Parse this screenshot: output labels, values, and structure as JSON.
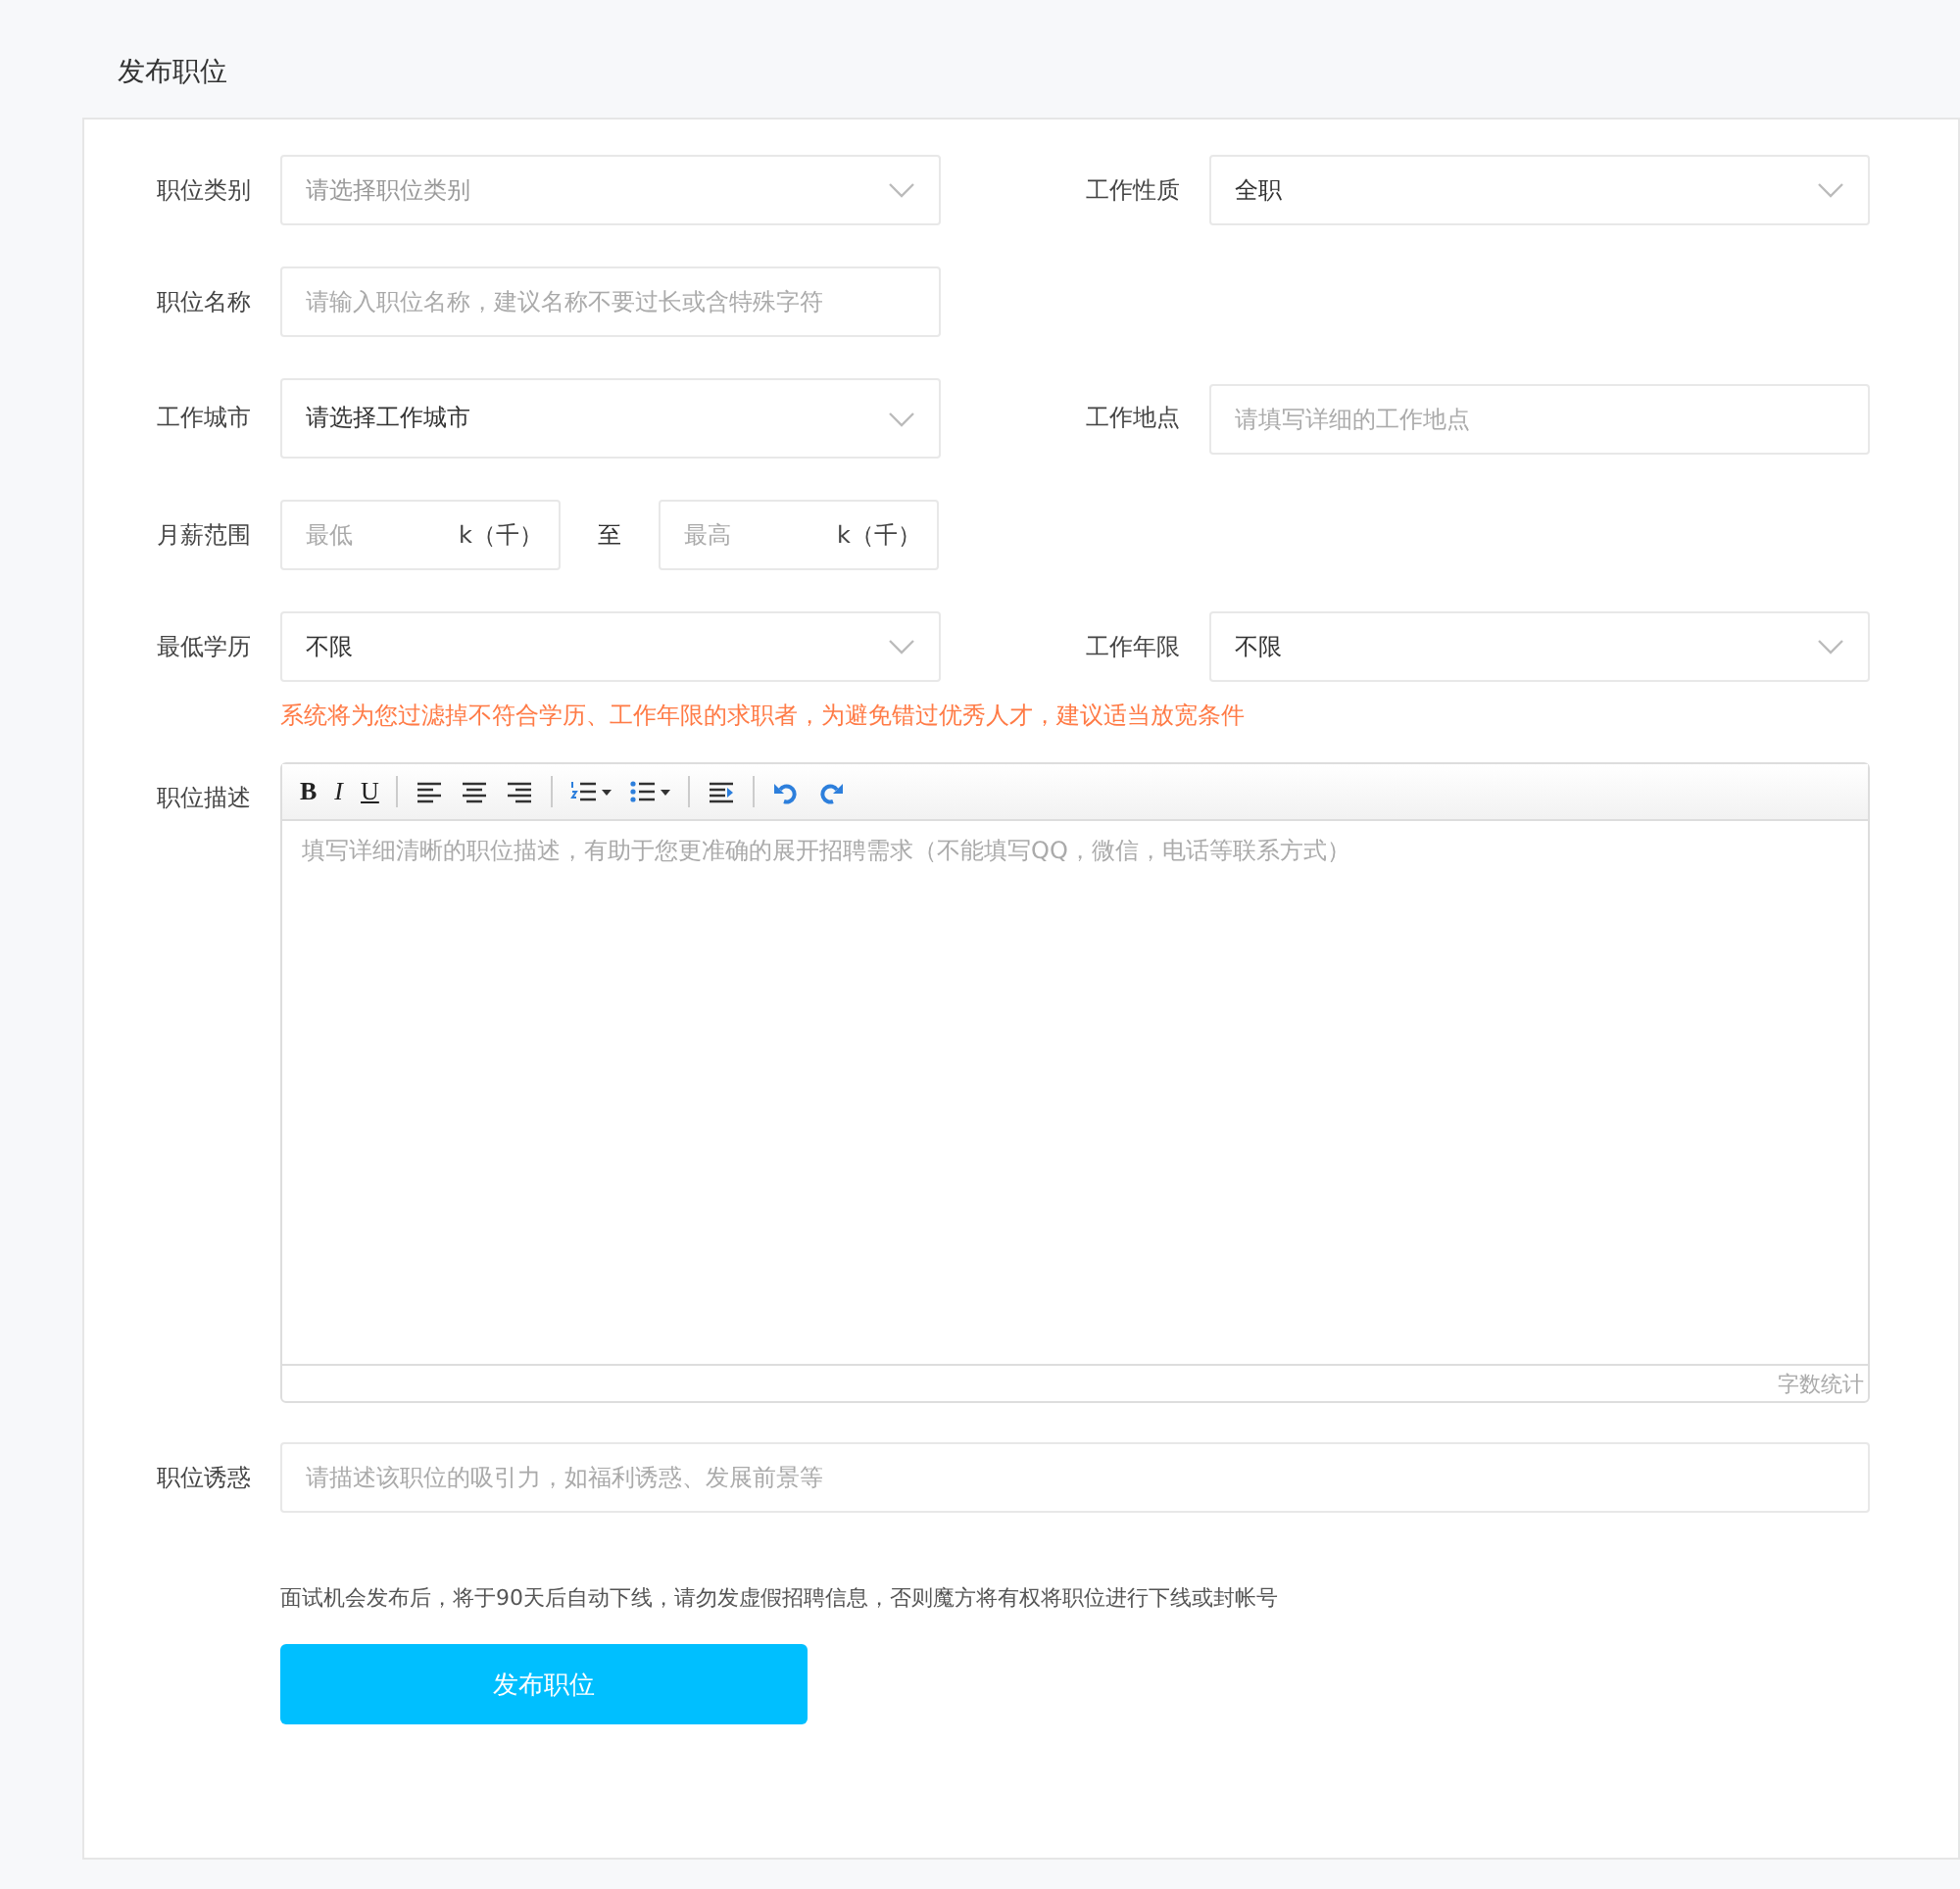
{
  "page": {
    "title": "发布职位"
  },
  "form": {
    "rows": [
      {
        "fields": [
          {
            "label": "职位类别",
            "kind": "select",
            "placeholder": "请选择职位类别"
          },
          {
            "label": "工作性质",
            "kind": "select",
            "value": "全职"
          }
        ]
      },
      {
        "fields": [
          {
            "label": "职位名称",
            "kind": "input",
            "placeholder": "请输入职位名称，建议名称不要过长或含特殊字符"
          }
        ]
      },
      {
        "fields": [
          {
            "label": "工作城市",
            "kind": "select",
            "value": "请选择工作城市",
            "tall": true
          },
          {
            "label": "工作地点",
            "kind": "input",
            "placeholder": "请填写详细的工作地点"
          }
        ]
      },
      {
        "fields": [
          {
            "label": "月薪范围",
            "kind": "range",
            "min_placeholder": "最低",
            "min_unit": "k（千）",
            "separator": "至",
            "max_placeholder": "最高",
            "max_unit": "k（千）"
          }
        ]
      },
      {
        "fields": [
          {
            "label": "最低学历",
            "kind": "select",
            "value": "不限"
          },
          {
            "label": "工作年限",
            "kind": "select",
            "value": "不限"
          }
        ]
      }
    ],
    "warning": "系统将为您过滤掉不符合学历、工作年限的求职者，为避免错过优秀人才，建议适当放宽条件",
    "editor": {
      "label": "职位描述",
      "toolbar": [
        {
          "kind": "bold",
          "label": "B"
        },
        {
          "kind": "italic",
          "label": "I"
        },
        {
          "kind": "underline",
          "label": "U"
        },
        {
          "kind": "separator"
        },
        {
          "kind": "align-left"
        },
        {
          "kind": "align-center"
        },
        {
          "kind": "align-right"
        },
        {
          "kind": "separator"
        },
        {
          "kind": "ordered-list",
          "dropdown": true
        },
        {
          "kind": "unordered-list",
          "dropdown": true
        },
        {
          "kind": "separator"
        },
        {
          "kind": "indent"
        },
        {
          "kind": "separator"
        },
        {
          "kind": "undo"
        },
        {
          "kind": "redo"
        }
      ],
      "placeholder": "填写详细清晰的职位描述，有助于您更准确的展开招聘需求（不能填写QQ，微信，电话等联系方式）",
      "word_count": "字数统计"
    },
    "attraction": {
      "label": "职位诱惑",
      "placeholder": "请描述该职位的吸引力，如福利诱惑、发展前景等"
    },
    "notice": "面试机会发布后，将于90天后自动下线，请勿发虚假招聘信息，否则魔方将有权将职位进行下线或封帐号",
    "submit": "发布职位"
  }
}
